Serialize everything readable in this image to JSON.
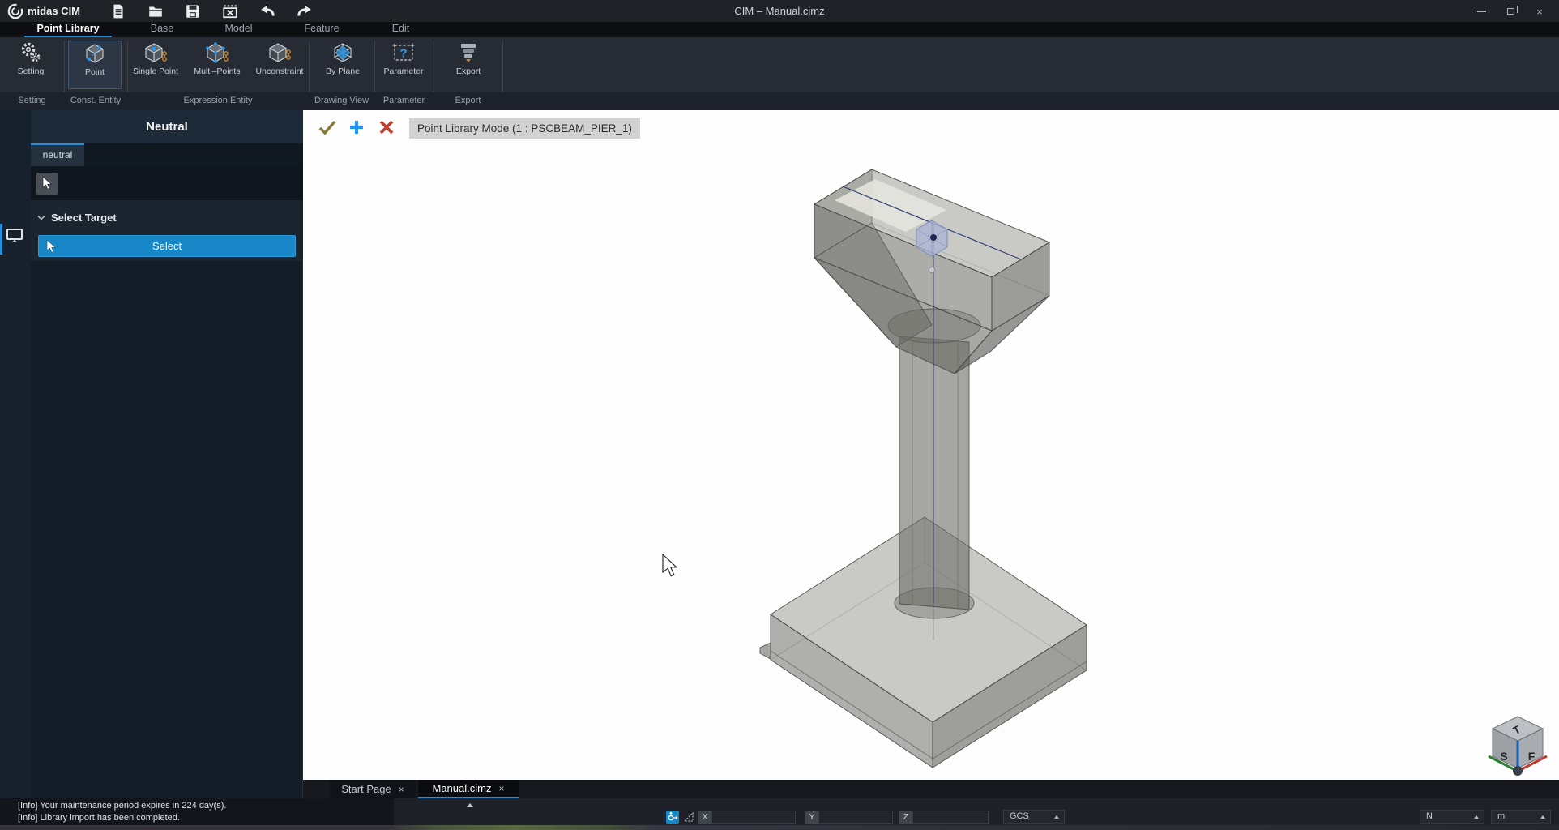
{
  "window": {
    "app_name": "midas CIM",
    "title": "CIM – Manual.cimz",
    "close_glyph": "×"
  },
  "menu": {
    "tabs": [
      "Point Library",
      "Base",
      "Model",
      "Feature",
      "Edit"
    ]
  },
  "ribbon": {
    "buttons": [
      "Setting",
      "Point",
      "Single Point",
      "Multi–Points",
      "Unconstraint",
      "By Plane",
      "Parameter",
      "Export"
    ],
    "groups": [
      "Setting",
      "Const. Entity",
      "Expression Entity",
      "Drawing View",
      "Parameter",
      "Export"
    ],
    "parameter_glyph": "?"
  },
  "sidebar": {
    "panel_title": "Neutral",
    "tab_label": "neutral",
    "section_title": "Select Target",
    "select_button": "Select"
  },
  "canvas": {
    "mode_chip": "Point Library Mode (1 : PSCBEAM_PIER_1)"
  },
  "doc_tabs": {
    "tab1": "Start Page",
    "tab2": "Manual.cimz",
    "close_glyph": "×"
  },
  "status": {
    "message1": "[Info] Your maintenance period expires in 224 day(s).",
    "message2": "[Info] Library import has been completed.",
    "x_label": "X",
    "y_label": "Y",
    "z_label": "Z",
    "gcs_label": "GCS",
    "direction_label": "N",
    "unit_label": "m"
  },
  "view_cube": {
    "top": "T",
    "left": "S",
    "right": "F"
  },
  "colors": {
    "accent_blue": "#2b8fd8",
    "select_button": "#1787c8",
    "confirm_check": "#8a7c3c",
    "add_blue": "#2196f3",
    "cancel_red": "#c23b2a",
    "model_grey": "#8c8c87",
    "guide_blue": "#1b2f6e"
  }
}
